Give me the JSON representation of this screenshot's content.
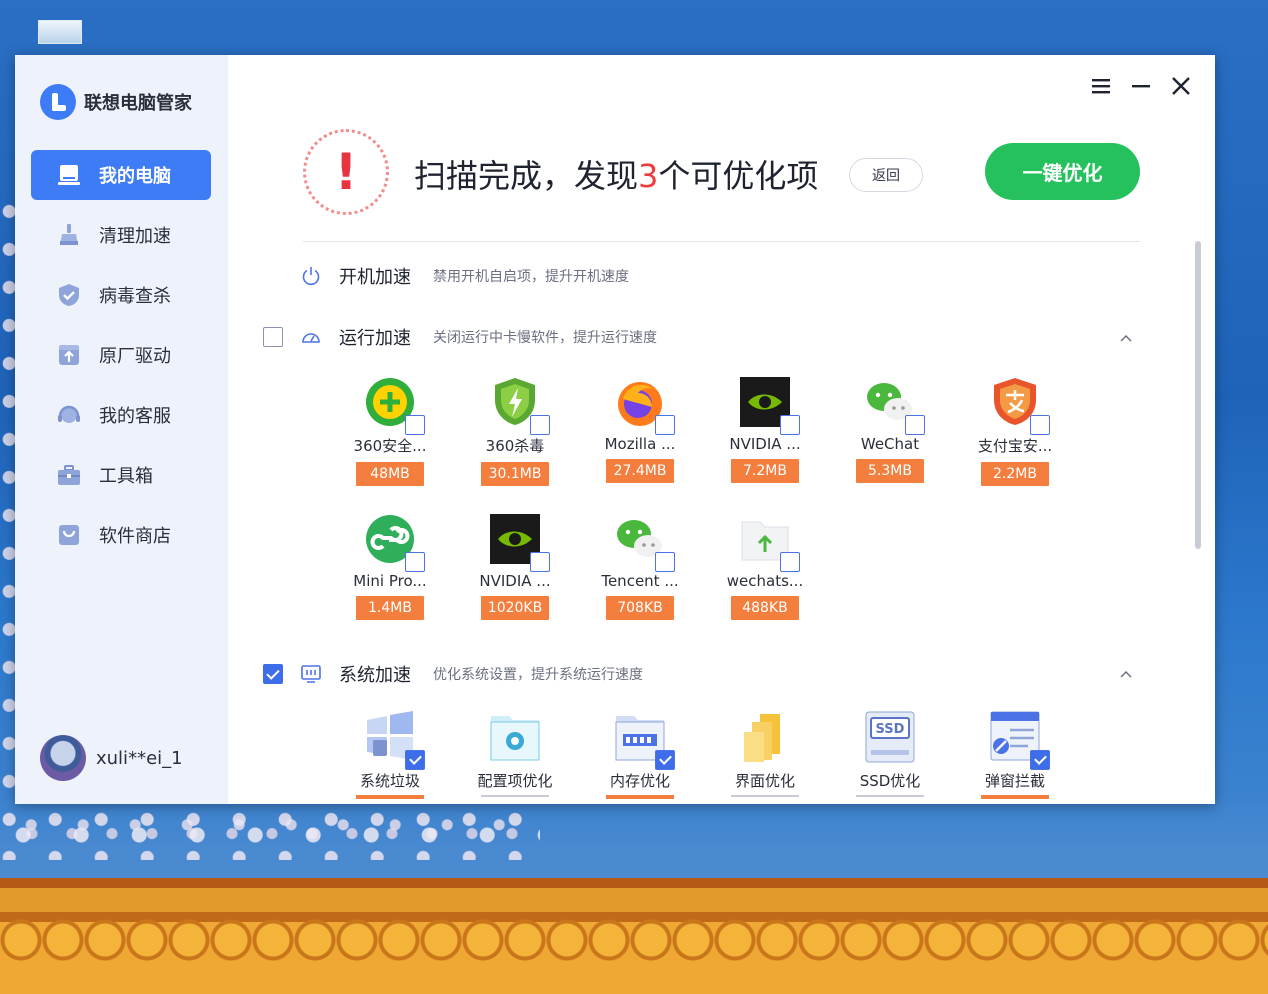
{
  "window": {
    "app_name": "联想电脑管家"
  },
  "sidebar": {
    "items": [
      {
        "label": "我的电脑",
        "icon": "laptop-icon",
        "active": true
      },
      {
        "label": "清理加速",
        "icon": "broom-icon",
        "active": false
      },
      {
        "label": "病毒查杀",
        "icon": "shield-icon",
        "active": false
      },
      {
        "label": "原厂驱动",
        "icon": "driver-upload-icon",
        "active": false
      },
      {
        "label": "我的客服",
        "icon": "headset-icon",
        "active": false
      },
      {
        "label": "工具箱",
        "icon": "toolbox-icon",
        "active": false
      },
      {
        "label": "软件商店",
        "icon": "store-bag-icon",
        "active": false
      }
    ],
    "user": {
      "name": "xuli**ei_1"
    }
  },
  "header": {
    "title_before": "扫描完成，发现",
    "count": "3",
    "title_after": "个可优化项",
    "back_label": "返回",
    "optimize_label": "一键优化"
  },
  "sections": {
    "startup": {
      "title": "开机加速",
      "desc": "禁用开机自启项，提升开机速度"
    },
    "runtime": {
      "title": "运行加速",
      "desc": "关闭运行中卡慢软件，提升运行速度",
      "checked": false,
      "apps": [
        {
          "name": "360安全...",
          "size": "48MB",
          "icon": "360-safe-icon"
        },
        {
          "name": "360杀毒",
          "size": "30.1MB",
          "icon": "360-antivirus-icon"
        },
        {
          "name": "Mozilla ...",
          "size": "27.4MB",
          "icon": "firefox-icon"
        },
        {
          "name": "NVIDIA ...",
          "size": "7.2MB",
          "icon": "nvidia-icon"
        },
        {
          "name": "WeChat",
          "size": "5.3MB",
          "icon": "wechat-icon"
        },
        {
          "name": "支付宝安...",
          "size": "2.2MB",
          "icon": "alipay-shield-icon"
        },
        {
          "name": "Mini Pro...",
          "size": "1.4MB",
          "icon": "mini-program-icon"
        },
        {
          "name": "NVIDIA ...",
          "size": "1020KB",
          "icon": "nvidia-icon"
        },
        {
          "name": "Tencent ...",
          "size": "708KB",
          "icon": "wechat-icon"
        },
        {
          "name": "wechats...",
          "size": "488KB",
          "icon": "folder-upload-icon"
        }
      ]
    },
    "system": {
      "title": "系统加速",
      "desc": "优化系统设置，提升系统运行速度",
      "checked": true,
      "items": [
        {
          "name": "系统垃圾",
          "icon": "system-junk-icon",
          "checked": true
        },
        {
          "name": "配置项优化",
          "icon": "config-gear-icon",
          "checked": false
        },
        {
          "name": "内存优化",
          "icon": "memory-icon",
          "checked": true
        },
        {
          "name": "界面优化",
          "icon": "ui-folders-icon",
          "checked": false
        },
        {
          "name": "SSD优化",
          "icon": "ssd-icon",
          "checked": false
        },
        {
          "name": "弹窗拦截",
          "icon": "popup-block-icon",
          "checked": true
        }
      ]
    }
  },
  "colors": {
    "accent": "#3d7cf5",
    "optimize_green": "#24c15d",
    "size_badge": "#f47e3e",
    "alert_red": "#e8343f"
  }
}
